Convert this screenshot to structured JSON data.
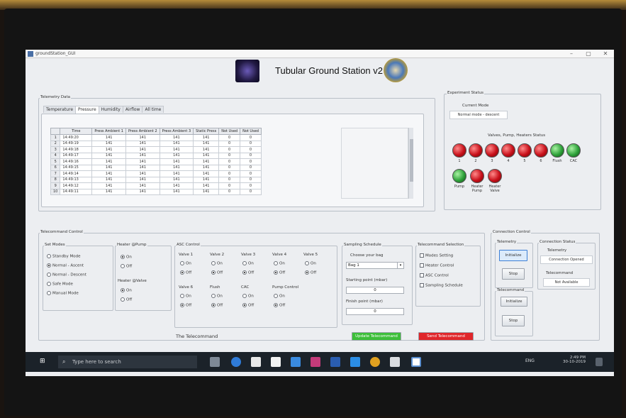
{
  "window": {
    "title": "groundStation_GUI"
  },
  "app": {
    "title": "Tubular Ground Station v2"
  },
  "telemetry": {
    "group_label": "Telemetry Data",
    "tabs": [
      "Temperature",
      "Pressure",
      "Humidity",
      "Airflow",
      "All time"
    ],
    "active_tab": "Pressure",
    "columns": [
      "Time",
      "Press Ambient 1",
      "Press Ambient 2",
      "Press Ambient 3",
      "Static Press",
      "Not Used",
      "Not Used"
    ],
    "rows": [
      [
        "1",
        "14:49:20",
        "141",
        "141",
        "141",
        "141",
        "0",
        "0"
      ],
      [
        "2",
        "14:49:19",
        "141",
        "141",
        "141",
        "141",
        "0",
        "0"
      ],
      [
        "3",
        "14:49:18",
        "141",
        "141",
        "141",
        "141",
        "0",
        "0"
      ],
      [
        "4",
        "14:49:17",
        "141",
        "141",
        "141",
        "141",
        "0",
        "0"
      ],
      [
        "5",
        "14:49:16",
        "141",
        "141",
        "141",
        "141",
        "0",
        "0"
      ],
      [
        "6",
        "14:49:15",
        "141",
        "141",
        "141",
        "141",
        "0",
        "0"
      ],
      [
        "7",
        "14:49:14",
        "141",
        "141",
        "141",
        "141",
        "0",
        "0"
      ],
      [
        "8",
        "14:49:13",
        "141",
        "141",
        "141",
        "141",
        "0",
        "0"
      ],
      [
        "9",
        "14:49:12",
        "141",
        "141",
        "141",
        "141",
        "0",
        "0"
      ],
      [
        "10",
        "14:49:11",
        "141",
        "141",
        "141",
        "141",
        "0",
        "0"
      ]
    ]
  },
  "experiment": {
    "group_label": "Experiment Status",
    "current_mode_label": "Current Mode",
    "current_mode_value": "Normal mode - descent",
    "valves_title": "Valves, Pump, Heaters Status",
    "leds": [
      {
        "label": "1",
        "color": "#c8101a"
      },
      {
        "label": "2",
        "color": "#c8101a"
      },
      {
        "label": "3",
        "color": "#c8101a"
      },
      {
        "label": "4",
        "color": "#c8101a"
      },
      {
        "label": "5",
        "color": "#c8101a"
      },
      {
        "label": "6",
        "color": "#c8101a"
      },
      {
        "label": "Flush",
        "color": "#2ea23a"
      },
      {
        "label": "CAC",
        "color": "#2ea23a"
      },
      {
        "label": "Pump",
        "color": "#2ea23a"
      },
      {
        "label": "Heater Pump",
        "color": "#c8101a"
      },
      {
        "label": "Heater Valve",
        "color": "#c8101a"
      }
    ]
  },
  "telecommand": {
    "group_label": "Telecommand Control",
    "set_modes_label": "Set Modes",
    "modes": [
      "Standby Mode",
      "Normal - Ascent",
      "Normal - Descent",
      "Safe Mode",
      "Manual Mode"
    ],
    "selected_mode": "Normal - Ascent",
    "heater_pump_label": "Heater @Pump",
    "heater_valve_label": "Heater @Valve",
    "on_label": "On",
    "off_label": "Off",
    "asc_label": "ASC Control",
    "valves_row1": [
      "Valve 1",
      "Valve 2",
      "Valve 3",
      "Valve 4",
      "Valve 5"
    ],
    "valves_row2": [
      "Valve 6",
      "Flush",
      "CAC"
    ],
    "pump_control_label": "Pump Control",
    "sampling": {
      "label": "Sampling Schedule",
      "choose_bag": "Choose your bag",
      "bag_value": "Bag 1",
      "start_label": "Starting point (mbar)",
      "start_value": "0",
      "final_label": "Finish point (mbar)",
      "final_value": "0"
    },
    "selection": {
      "label": "Telecommand Selection",
      "options": [
        "Modes Setting",
        "Heater Control",
        "ASC Control",
        "Sampling Schedule"
      ]
    },
    "the_tc_label": "The Telecommand",
    "update_button": "Update Telecommand",
    "send_button": "Send Telecommand",
    "update_color": "#3dbf3a",
    "send_color": "#e0262b"
  },
  "connection": {
    "group_label": "Connection Control",
    "telemetry_label": "Telemetry",
    "telecommand_label": "Telecommand",
    "initialize": "Initialize",
    "stop": "Stop",
    "status_label": "Connection Status",
    "tm_status_label": "Telemetry",
    "tm_status_value": "Connection Opened",
    "tc_status_label": "Telecommand",
    "tc_status_value": "Not Available"
  },
  "taskbar": {
    "search_placeholder": "Type here to search",
    "time": "2:49 PM",
    "date": "30-10-2019",
    "lang": "ENG"
  }
}
